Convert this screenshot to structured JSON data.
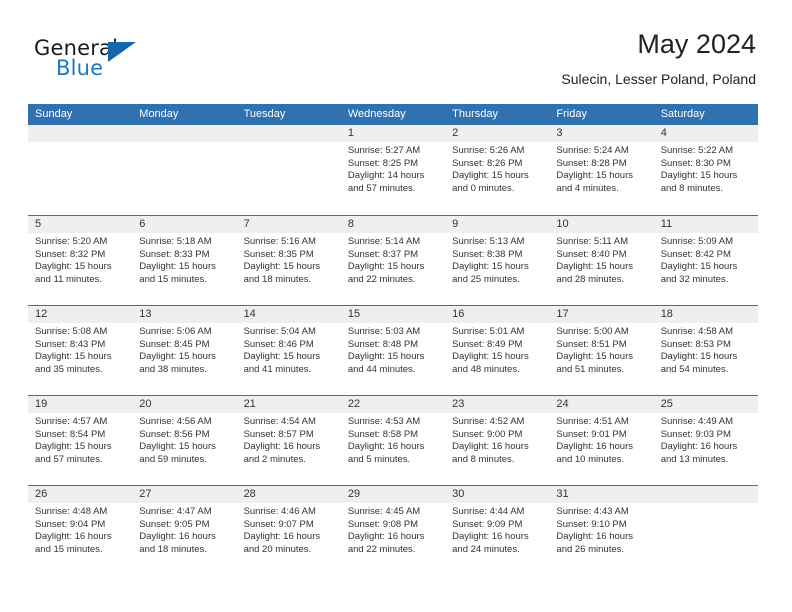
{
  "brand": {
    "line1": "General",
    "line2": "Blue",
    "triangle_icon": "triangle-logo-icon",
    "accent_color": "#1c79c0"
  },
  "header": {
    "title": "May 2024",
    "subtitle": "Sulecin, Lesser Poland, Poland"
  },
  "colors": {
    "header_blue": "#3071b0",
    "day_number_bg": "#efefef",
    "text": "#333333"
  },
  "weekday_headers": [
    "Sunday",
    "Monday",
    "Tuesday",
    "Wednesday",
    "Thursday",
    "Friday",
    "Saturday"
  ],
  "weeks": [
    [
      {
        "day": "",
        "empty": true
      },
      {
        "day": "",
        "empty": true
      },
      {
        "day": "",
        "empty": true
      },
      {
        "day": "1",
        "sunrise": "Sunrise: 5:27 AM",
        "sunset": "Sunset: 8:25 PM",
        "daylight": "Daylight: 14 hours and 57 minutes."
      },
      {
        "day": "2",
        "sunrise": "Sunrise: 5:26 AM",
        "sunset": "Sunset: 8:26 PM",
        "daylight": "Daylight: 15 hours and 0 minutes."
      },
      {
        "day": "3",
        "sunrise": "Sunrise: 5:24 AM",
        "sunset": "Sunset: 8:28 PM",
        "daylight": "Daylight: 15 hours and 4 minutes."
      },
      {
        "day": "4",
        "sunrise": "Sunrise: 5:22 AM",
        "sunset": "Sunset: 8:30 PM",
        "daylight": "Daylight: 15 hours and 8 minutes."
      }
    ],
    [
      {
        "day": "5",
        "sunrise": "Sunrise: 5:20 AM",
        "sunset": "Sunset: 8:32 PM",
        "daylight": "Daylight: 15 hours and 11 minutes."
      },
      {
        "day": "6",
        "sunrise": "Sunrise: 5:18 AM",
        "sunset": "Sunset: 8:33 PM",
        "daylight": "Daylight: 15 hours and 15 minutes."
      },
      {
        "day": "7",
        "sunrise": "Sunrise: 5:16 AM",
        "sunset": "Sunset: 8:35 PM",
        "daylight": "Daylight: 15 hours and 18 minutes."
      },
      {
        "day": "8",
        "sunrise": "Sunrise: 5:14 AM",
        "sunset": "Sunset: 8:37 PM",
        "daylight": "Daylight: 15 hours and 22 minutes."
      },
      {
        "day": "9",
        "sunrise": "Sunrise: 5:13 AM",
        "sunset": "Sunset: 8:38 PM",
        "daylight": "Daylight: 15 hours and 25 minutes."
      },
      {
        "day": "10",
        "sunrise": "Sunrise: 5:11 AM",
        "sunset": "Sunset: 8:40 PM",
        "daylight": "Daylight: 15 hours and 28 minutes."
      },
      {
        "day": "11",
        "sunrise": "Sunrise: 5:09 AM",
        "sunset": "Sunset: 8:42 PM",
        "daylight": "Daylight: 15 hours and 32 minutes."
      }
    ],
    [
      {
        "day": "12",
        "sunrise": "Sunrise: 5:08 AM",
        "sunset": "Sunset: 8:43 PM",
        "daylight": "Daylight: 15 hours and 35 minutes."
      },
      {
        "day": "13",
        "sunrise": "Sunrise: 5:06 AM",
        "sunset": "Sunset: 8:45 PM",
        "daylight": "Daylight: 15 hours and 38 minutes."
      },
      {
        "day": "14",
        "sunrise": "Sunrise: 5:04 AM",
        "sunset": "Sunset: 8:46 PM",
        "daylight": "Daylight: 15 hours and 41 minutes."
      },
      {
        "day": "15",
        "sunrise": "Sunrise: 5:03 AM",
        "sunset": "Sunset: 8:48 PM",
        "daylight": "Daylight: 15 hours and 44 minutes."
      },
      {
        "day": "16",
        "sunrise": "Sunrise: 5:01 AM",
        "sunset": "Sunset: 8:49 PM",
        "daylight": "Daylight: 15 hours and 48 minutes."
      },
      {
        "day": "17",
        "sunrise": "Sunrise: 5:00 AM",
        "sunset": "Sunset: 8:51 PM",
        "daylight": "Daylight: 15 hours and 51 minutes."
      },
      {
        "day": "18",
        "sunrise": "Sunrise: 4:58 AM",
        "sunset": "Sunset: 8:53 PM",
        "daylight": "Daylight: 15 hours and 54 minutes."
      }
    ],
    [
      {
        "day": "19",
        "sunrise": "Sunrise: 4:57 AM",
        "sunset": "Sunset: 8:54 PM",
        "daylight": "Daylight: 15 hours and 57 minutes."
      },
      {
        "day": "20",
        "sunrise": "Sunrise: 4:56 AM",
        "sunset": "Sunset: 8:56 PM",
        "daylight": "Daylight: 15 hours and 59 minutes."
      },
      {
        "day": "21",
        "sunrise": "Sunrise: 4:54 AM",
        "sunset": "Sunset: 8:57 PM",
        "daylight": "Daylight: 16 hours and 2 minutes."
      },
      {
        "day": "22",
        "sunrise": "Sunrise: 4:53 AM",
        "sunset": "Sunset: 8:58 PM",
        "daylight": "Daylight: 16 hours and 5 minutes."
      },
      {
        "day": "23",
        "sunrise": "Sunrise: 4:52 AM",
        "sunset": "Sunset: 9:00 PM",
        "daylight": "Daylight: 16 hours and 8 minutes."
      },
      {
        "day": "24",
        "sunrise": "Sunrise: 4:51 AM",
        "sunset": "Sunset: 9:01 PM",
        "daylight": "Daylight: 16 hours and 10 minutes."
      },
      {
        "day": "25",
        "sunrise": "Sunrise: 4:49 AM",
        "sunset": "Sunset: 9:03 PM",
        "daylight": "Daylight: 16 hours and 13 minutes."
      }
    ],
    [
      {
        "day": "26",
        "sunrise": "Sunrise: 4:48 AM",
        "sunset": "Sunset: 9:04 PM",
        "daylight": "Daylight: 16 hours and 15 minutes."
      },
      {
        "day": "27",
        "sunrise": "Sunrise: 4:47 AM",
        "sunset": "Sunset: 9:05 PM",
        "daylight": "Daylight: 16 hours and 18 minutes."
      },
      {
        "day": "28",
        "sunrise": "Sunrise: 4:46 AM",
        "sunset": "Sunset: 9:07 PM",
        "daylight": "Daylight: 16 hours and 20 minutes."
      },
      {
        "day": "29",
        "sunrise": "Sunrise: 4:45 AM",
        "sunset": "Sunset: 9:08 PM",
        "daylight": "Daylight: 16 hours and 22 minutes."
      },
      {
        "day": "30",
        "sunrise": "Sunrise: 4:44 AM",
        "sunset": "Sunset: 9:09 PM",
        "daylight": "Daylight: 16 hours and 24 minutes."
      },
      {
        "day": "31",
        "sunrise": "Sunrise: 4:43 AM",
        "sunset": "Sunset: 9:10 PM",
        "daylight": "Daylight: 16 hours and 26 minutes."
      },
      {
        "day": "",
        "empty": true
      }
    ]
  ]
}
